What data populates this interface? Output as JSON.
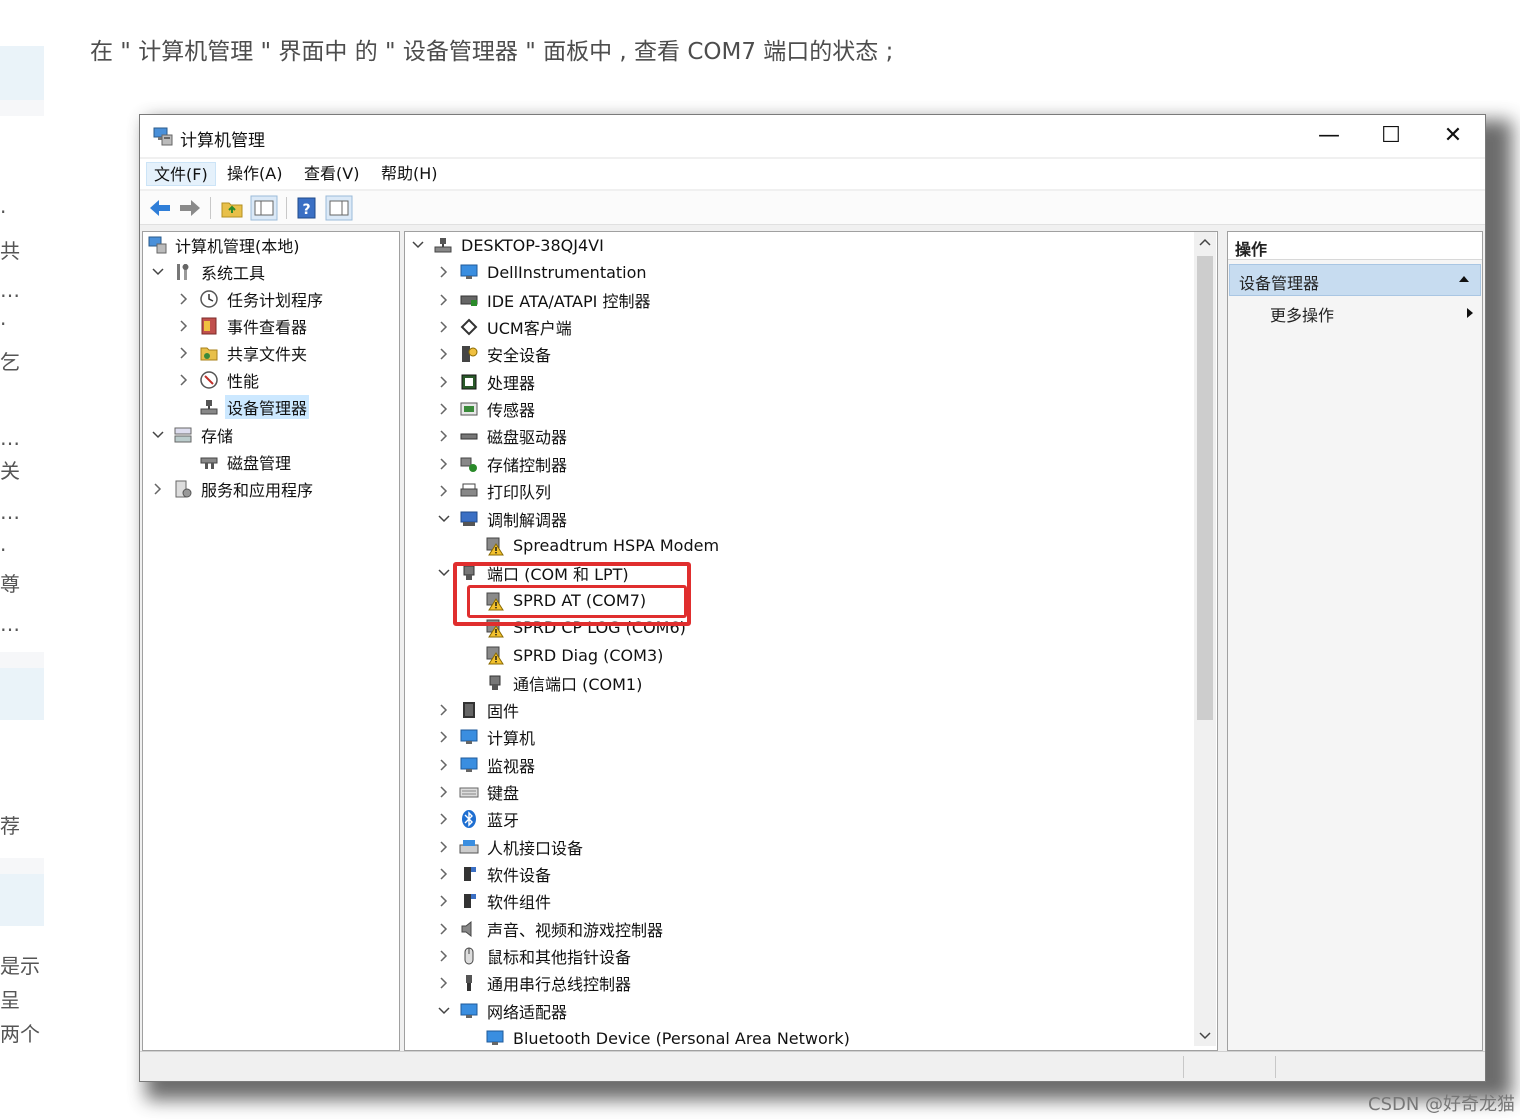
{
  "caption": "在 \" 计算机管理 \" 界面中 的 \" 设备管理器 \" 面板中 , 查看 COM7 端口的状态 ;",
  "left_strip_chars": [
    "·",
    "共",
    "…",
    "·",
    "乞",
    "…",
    "关",
    "…",
    "·",
    "尊",
    "…",
    "荐",
    "是示",
    "呈",
    "两个"
  ],
  "window": {
    "title": "计算机管理",
    "controls": {
      "minimize": "—",
      "maximize": "☐",
      "close": "✕"
    }
  },
  "menu": [
    "文件(F)",
    "操作(A)",
    "查看(V)",
    "帮助(H)"
  ],
  "left_tree": [
    {
      "label": "计算机管理(本地)",
      "icon": "computer-management-icon"
    },
    {
      "label": "系统工具",
      "icon": "system-tools-icon"
    },
    {
      "label": "任务计划程序",
      "icon": "task-scheduler-icon"
    },
    {
      "label": "事件查看器",
      "icon": "event-viewer-icon"
    },
    {
      "label": "共享文件夹",
      "icon": "shared-folders-icon"
    },
    {
      "label": "性能",
      "icon": "performance-icon"
    },
    {
      "label": "设备管理器",
      "icon": "device-manager-icon"
    },
    {
      "label": "存储",
      "icon": "storage-icon"
    },
    {
      "label": "磁盘管理",
      "icon": "disk-management-icon"
    },
    {
      "label": "服务和应用程序",
      "icon": "services-icon"
    }
  ],
  "device_tree": [
    {
      "label": "DESKTOP-38QJ4VI",
      "icon": "computer-root-icon"
    },
    {
      "label": "DellInstrumentation",
      "icon": "dell-instrumentation-icon"
    },
    {
      "label": "IDE ATA/ATAPI 控制器",
      "icon": "ide-controller-icon"
    },
    {
      "label": "UCM客户端",
      "icon": "ucm-client-icon"
    },
    {
      "label": "安全设备",
      "icon": "security-device-icon"
    },
    {
      "label": "处理器",
      "icon": "processor-icon"
    },
    {
      "label": "传感器",
      "icon": "sensor-icon"
    },
    {
      "label": "磁盘驱动器",
      "icon": "disk-drive-icon"
    },
    {
      "label": "存储控制器",
      "icon": "storage-controller-icon"
    },
    {
      "label": "打印队列",
      "icon": "print-queue-icon"
    },
    {
      "label": "调制解调器",
      "icon": "modem-icon"
    },
    {
      "label": "Spreadtrum HSPA Modem",
      "icon": "modem-warning-icon"
    },
    {
      "label": "端口 (COM 和 LPT)",
      "icon": "ports-icon"
    },
    {
      "label": "SPRD AT (COM7)",
      "icon": "port-warning-icon"
    },
    {
      "label": "SPRD CP LOG (COM6)",
      "icon": "port-warning-icon"
    },
    {
      "label": "SPRD Diag (COM3)",
      "icon": "port-warning-icon"
    },
    {
      "label": "通信端口 (COM1)",
      "icon": "port-icon"
    },
    {
      "label": "固件",
      "icon": "firmware-icon"
    },
    {
      "label": "计算机",
      "icon": "computer-icon"
    },
    {
      "label": "监视器",
      "icon": "monitor-icon"
    },
    {
      "label": "键盘",
      "icon": "keyboard-icon"
    },
    {
      "label": "蓝牙",
      "icon": "bluetooth-icon"
    },
    {
      "label": "人机接口设备",
      "icon": "hid-icon"
    },
    {
      "label": "软件设备",
      "icon": "software-device-icon"
    },
    {
      "label": "软件组件",
      "icon": "software-component-icon"
    },
    {
      "label": "声音、视频和游戏控制器",
      "icon": "sound-icon"
    },
    {
      "label": "鼠标和其他指针设备",
      "icon": "mouse-icon"
    },
    {
      "label": "通用串行总线控制器",
      "icon": "usb-icon"
    },
    {
      "label": "网络适配器",
      "icon": "network-adapter-icon"
    },
    {
      "label": "Bluetooth Device (Personal Area Network)",
      "icon": "network-device-icon"
    }
  ],
  "actions": {
    "header": "操作",
    "section": "设备管理器",
    "more": "更多操作"
  },
  "watermark": "CSDN @好奇龙猫",
  "colors": {
    "highlight": "#e02e2e",
    "selection": "#cce8ff",
    "action_selected": "#c7dcf0"
  }
}
